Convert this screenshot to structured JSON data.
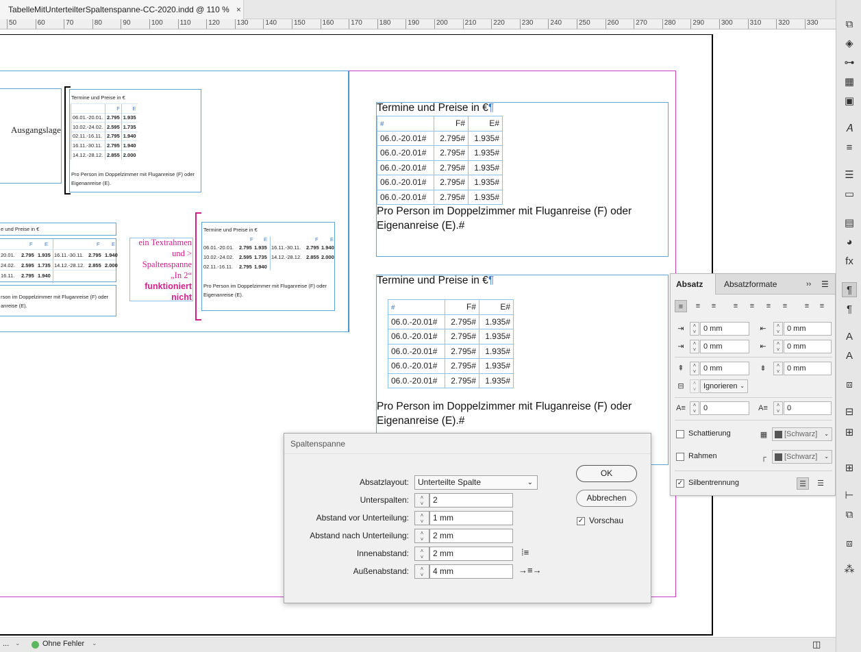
{
  "document": {
    "tab_title": "TabelleMitUnterteilterSpaltenspanne-CC-2020.indd @ 110 %",
    "close_glyph": "×"
  },
  "ruler": {
    "ticks": [
      "50",
      "60",
      "70",
      "80",
      "90",
      "100",
      "110",
      "120",
      "130",
      "140",
      "150",
      "160",
      "170",
      "180",
      "190",
      "200",
      "210",
      "220",
      "230",
      "240",
      "250",
      "260",
      "270",
      "280",
      "290",
      "300",
      "310",
      "320",
      "330"
    ]
  },
  "left_page": {
    "ausgangslage": "Ausgangslage",
    "small_title": "Termine und Preise in €",
    "small_head": [
      "",
      "F",
      "E"
    ],
    "small_rows": [
      [
        "06.01.-20.01.",
        "2.795",
        "1.935"
      ],
      [
        "10.02.-24.02.",
        "2.595",
        "1.735"
      ],
      [
        "02.11.-16.11.",
        "2.795",
        "1.940"
      ],
      [
        "16.11.-30.11.",
        "2.795",
        "1.940"
      ],
      [
        "14.12.-28.12.",
        "2.855",
        "2.000"
      ]
    ],
    "small_note": "Pro Person im Doppelzimmer mit Fluganreise (F) oder Eigenanreise (E).",
    "cut_title": "e und Preise in €",
    "cut_head": [
      "F",
      "E",
      "F",
      "E"
    ],
    "cut_rows": [
      [
        "20.01.",
        "2.795",
        "1.935",
        "16.11.-30.11.",
        "2.795",
        "1.940"
      ],
      [
        "24.02.",
        "2.595",
        "1.735",
        "14.12.-28.12.",
        "2.855",
        "2.000"
      ],
      [
        "16.11.",
        "2.795",
        "1.940",
        "",
        "",
        ""
      ]
    ],
    "cut_note_1": "rson im Doppelzimmer mit Fluganreise (F) oder",
    "cut_note_2": "anreise (E).",
    "magenta_note_1": "ein Textrahmen",
    "magenta_note_2": "und >",
    "magenta_note_3": "Spaltenspanne",
    "magenta_note_4": "„In 2“",
    "magenta_note_5": "funktioniert",
    "magenta_note_6": "nicht",
    "split_title": "Termine und Preise in €",
    "split_head": [
      "F",
      "E",
      "F",
      "E"
    ],
    "split_rows": [
      [
        "06.01.-20.01.",
        "2.795",
        "1.935",
        "16.11.-30.11.",
        "2.795",
        "1.940"
      ],
      [
        "10.02.-24.02.",
        "2.595",
        "1.735",
        "14.12.-28.12.",
        "2.855",
        "2.000"
      ],
      [
        "02.11.-16.11.",
        "2.795",
        "1.940",
        "",
        "",
        ""
      ]
    ],
    "split_note_1": "Pro Person im Doppelzimmer mit Fluganreise (F) oder",
    "split_note_2": "Eigenanreise (E)."
  },
  "right_page": {
    "title": "Termine und Preise in €",
    "pilcrow": "¶",
    "hash": "#",
    "head": [
      "#",
      "F#",
      "E#"
    ],
    "rows": [
      [
        "06.0.-20.01#",
        "2.795#",
        "1.935#"
      ],
      [
        "06.0.-20.01#",
        "2.795#",
        "1.935#"
      ],
      [
        "06.0.-20.01#",
        "2.795#",
        "1.935#"
      ],
      [
        "06.0.-20.01#",
        "2.795#",
        "1.935#"
      ],
      [
        "06.0.-20.01#",
        "2.795#",
        "1.935#"
      ]
    ],
    "note_line1": "Pro Person im Doppelzimmer mit Fluganreise (F) oder",
    "note_line2": "Eigenanreise (E).#"
  },
  "absatz_panel": {
    "tab_active": "Absatz",
    "tab_other": "Absatzformate",
    "more_glyph": "››",
    "indent_left": "0 mm",
    "indent_right": "0 mm",
    "first_line": "0 mm",
    "last_line": "0 mm",
    "space_before": "0 mm",
    "space_after": "0 mm",
    "grid_align": "Ignorieren",
    "dropcap_lines": "0",
    "dropcap_chars": "0",
    "shading_label": "Schattierung",
    "shading_color": "[Schwarz]",
    "border_label": "Rahmen",
    "border_color": "[Schwarz]",
    "hyphen_label": "Silbentrennung"
  },
  "dialog": {
    "title": "Spaltenspanne",
    "absatzlayout_label": "Absatzlayout:",
    "absatzlayout_value": "Unterteilte Spalte",
    "unterspalten_label": "Unterspalten:",
    "unterspalten_value": "2",
    "abstand_vor_label": "Abstand vor Unterteilung:",
    "abstand_vor_value": "1 mm",
    "abstand_nach_label": "Abstand nach Unterteilung:",
    "abstand_nach_value": "2 mm",
    "innen_label": "Innenabstand:",
    "innen_value": "2 mm",
    "aussen_label": "Außenabstand:",
    "aussen_value": "4 mm",
    "ok": "OK",
    "cancel": "Abbrechen",
    "preview": "Vorschau",
    "preview_checked": true
  },
  "status": {
    "errors": "Ohne Fehler",
    "ellipsis": "..."
  },
  "sidebar_icons": [
    "pages-icon",
    "layers-icon",
    "links-icon",
    "swatches-icon",
    "stroke-icon",
    "character-styles-icon",
    "align-icon",
    "lines-icon",
    "gradient-icon",
    "text-wrap-icon",
    "color-icon",
    "effects-icon",
    "paragraph-icon",
    "paragraph-styles-icon",
    "character-icon",
    "glyphs-icon",
    "transform-icon",
    "table-styles-icon",
    "cell-styles-icon",
    "table-icon",
    "align-objects-icon",
    "pathfinder-icon",
    "object-styles-icon",
    "scripts-icon"
  ]
}
